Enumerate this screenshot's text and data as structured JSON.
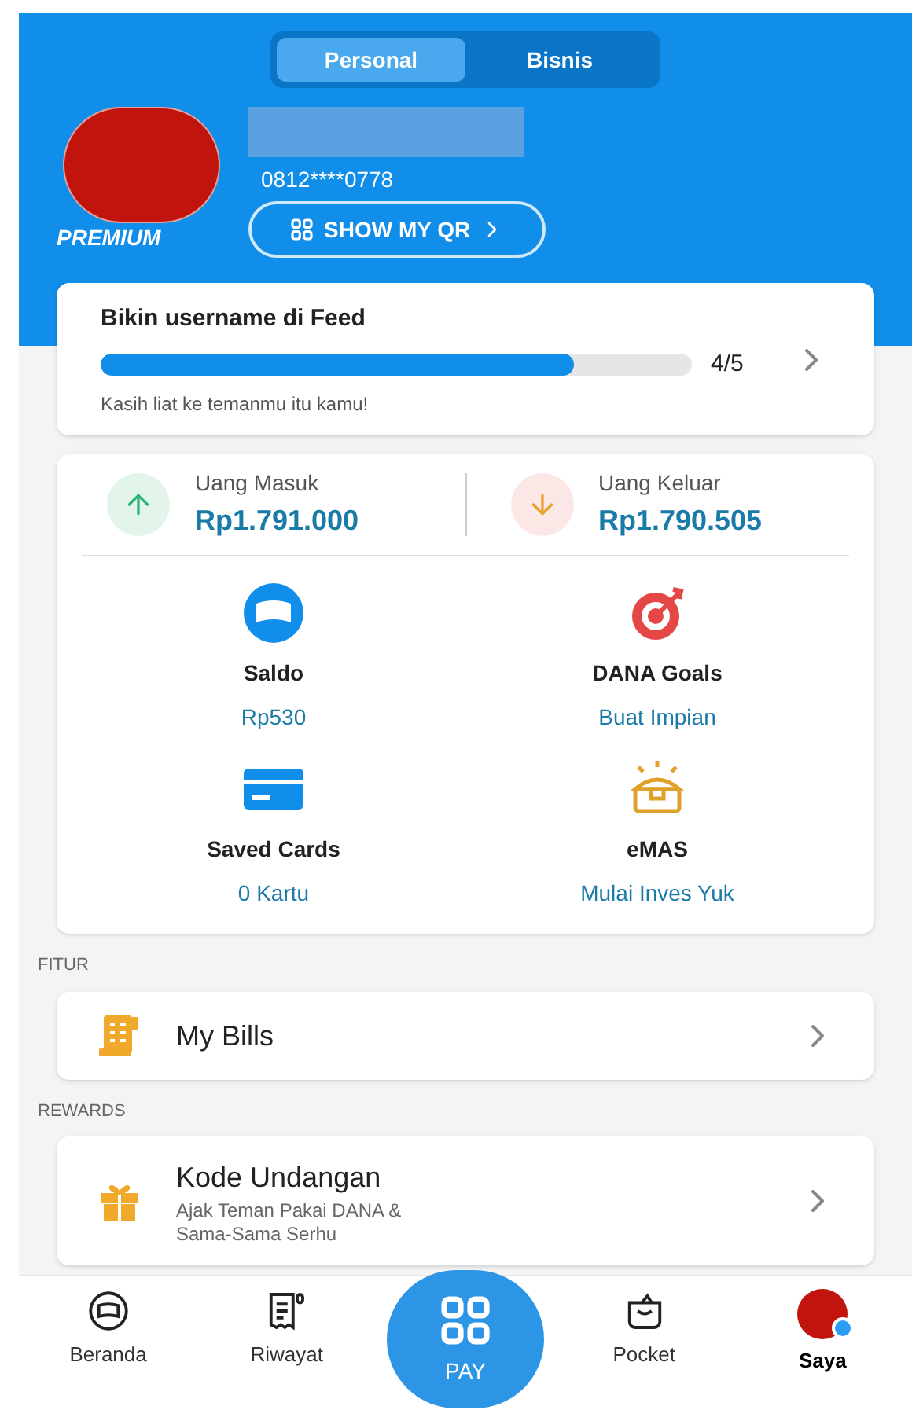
{
  "account_tabs": [
    {
      "label": "Personal",
      "selected": true
    },
    {
      "label": "Bisnis",
      "selected": false
    }
  ],
  "profile": {
    "badge": "PREMIUM",
    "phone": "0812****0778",
    "qr_button": "SHOW MY QR"
  },
  "username_task": {
    "title": "Bikin username di Feed",
    "level": 0.8,
    "progress": "4/5",
    "subtitle": "Kasih liat ke temanmu itu kamu!"
  },
  "cashflow": [
    {
      "kind": "in",
      "label": "Uang Masuk",
      "amount": "Rp1.791.000"
    },
    {
      "kind": "out",
      "label": "Uang Keluar",
      "amount": "Rp1.790.505"
    }
  ],
  "wallet_items": [
    {
      "kind": "saldo",
      "title": "Saldo",
      "subtitle": "Rp530"
    },
    {
      "kind": "goals",
      "title": "DANA Goals",
      "subtitle": "Buat Impian"
    },
    {
      "kind": "cards",
      "title": "Saved Cards",
      "subtitle": "0 Kartu"
    },
    {
      "kind": "emas",
      "title": "eMAS",
      "subtitle": "Mulai Inves Yuk"
    }
  ],
  "sections": [
    {
      "heading": "FITUR",
      "items": [
        {
          "kind": "bills",
          "title": "My Bills"
        }
      ]
    },
    {
      "heading": "REWARDS",
      "items": [
        {
          "kind": "gift",
          "title": "Kode Undangan",
          "subtitle": "Ajak Teman Pakai DANA &",
          "subtitle_2": "Sama-Sama Serhu"
        }
      ]
    }
  ],
  "bottom_nav": [
    {
      "kind": "home",
      "label": "Beranda",
      "selected": false
    },
    {
      "kind": "history",
      "label": "Riwayat",
      "selected": false
    },
    {
      "kind": "pay",
      "label": "PAY",
      "selected": false
    },
    {
      "kind": "pocket",
      "label": "Pocket",
      "selected": false
    },
    {
      "kind": "profile",
      "label": "Saya",
      "selected": true
    }
  ]
}
